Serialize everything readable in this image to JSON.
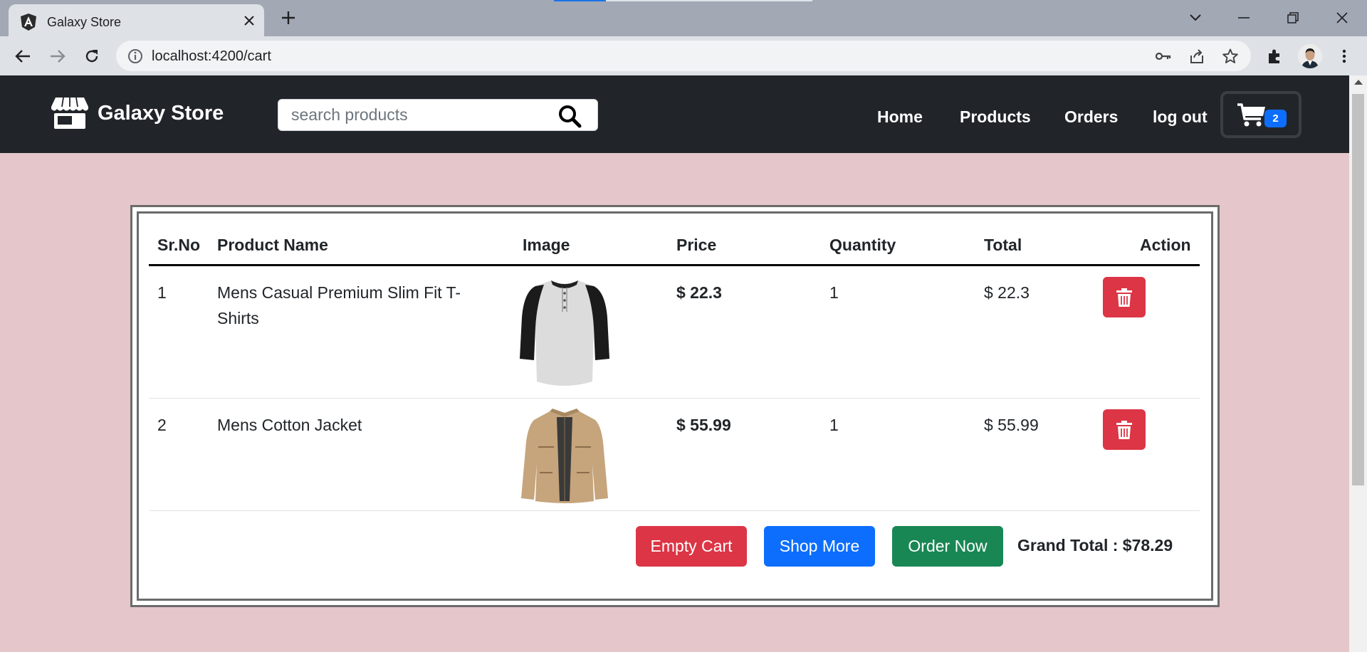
{
  "browser": {
    "tab_title": "Galaxy Store",
    "url": "localhost:4200/cart"
  },
  "navbar": {
    "brand": "Galaxy Store",
    "search_placeholder": "search products",
    "links": [
      "Home",
      "Products",
      "Orders",
      "log out"
    ],
    "cart_count": "2"
  },
  "cart": {
    "headers": [
      "Sr.No",
      "Product Name",
      "Image",
      "Price",
      "Quantity",
      "Total",
      "Action"
    ],
    "rows": [
      {
        "sr": "1",
        "name": "Mens Casual Premium Slim Fit T-Shirts",
        "image": "tshirt-image",
        "price": "$ 22.3",
        "quantity": "1",
        "total": "$ 22.3"
      },
      {
        "sr": "2",
        "name": "Mens Cotton Jacket",
        "image": "jacket-image",
        "price": "$ 55.99",
        "quantity": "1",
        "total": "$ 55.99"
      }
    ],
    "buttons": {
      "empty": "Empty Cart",
      "shop_more": "Shop More",
      "order_now": "Order Now"
    },
    "grand_total": "Grand Total : $78.29"
  },
  "colors": {
    "page_bg": "#e5c6cb",
    "navbar_bg": "#212529",
    "danger": "#dc3545",
    "primary": "#0d6efd",
    "success": "#198754"
  }
}
